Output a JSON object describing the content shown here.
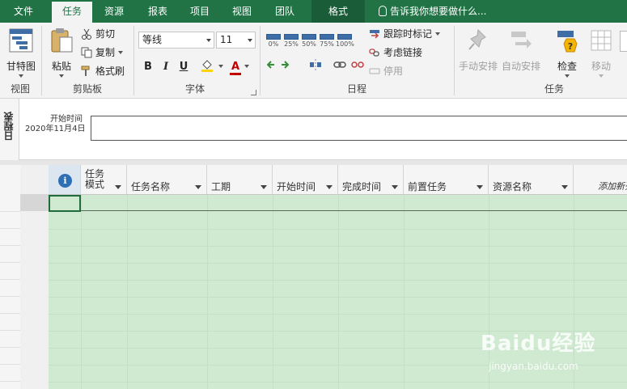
{
  "tabs": [
    {
      "label": "文件",
      "active": false
    },
    {
      "label": "任务",
      "active": true
    },
    {
      "label": "资源",
      "active": false
    },
    {
      "label": "报表",
      "active": false
    },
    {
      "label": "项目",
      "active": false
    },
    {
      "label": "视图",
      "active": false
    },
    {
      "label": "团队",
      "active": false
    },
    {
      "label": "格式",
      "active": false
    }
  ],
  "tell_me": "告诉我你想要做什么...",
  "ribbon": {
    "view": {
      "gantt": "甘特图",
      "group": "视图"
    },
    "clipboard": {
      "paste": "粘贴",
      "cut": "剪切",
      "copy": "复制",
      "format_painter": "格式刷",
      "group": "剪贴板"
    },
    "font": {
      "family": "等线",
      "size": "11",
      "bold": "B",
      "italic": "I",
      "underline": "U",
      "fill": "",
      "color": "A",
      "group": "字体"
    },
    "schedule": {
      "percents": [
        "0%",
        "25%",
        "50%",
        "75%",
        "100%"
      ],
      "mark_on_track": "跟踪时标记",
      "respect_links": "考虑链接",
      "inactivate": "停用",
      "group": "日程"
    },
    "tasks": {
      "manual": "手动安排",
      "auto": "自动安排",
      "inspect": "检查",
      "move": "移动",
      "group": "任务"
    }
  },
  "timeline": {
    "label": "日程表",
    "start_label": "开始时间",
    "start_date": "2020年11月4日"
  },
  "grid": {
    "columns": [
      {
        "line1": "任务",
        "line2": "模式"
      },
      {
        "label": "任务名称"
      },
      {
        "label": "工期"
      },
      {
        "label": "开始时间"
      },
      {
        "label": "完成时间"
      },
      {
        "label": "前置任务"
      },
      {
        "label": "资源名称"
      }
    ],
    "add_column": "添加新列"
  },
  "watermark": {
    "logo": "Baidu经验",
    "url": "jingyan.baidu.com"
  },
  "colors": {
    "brand": "#217346",
    "grid_fill": "#d0ead2"
  }
}
